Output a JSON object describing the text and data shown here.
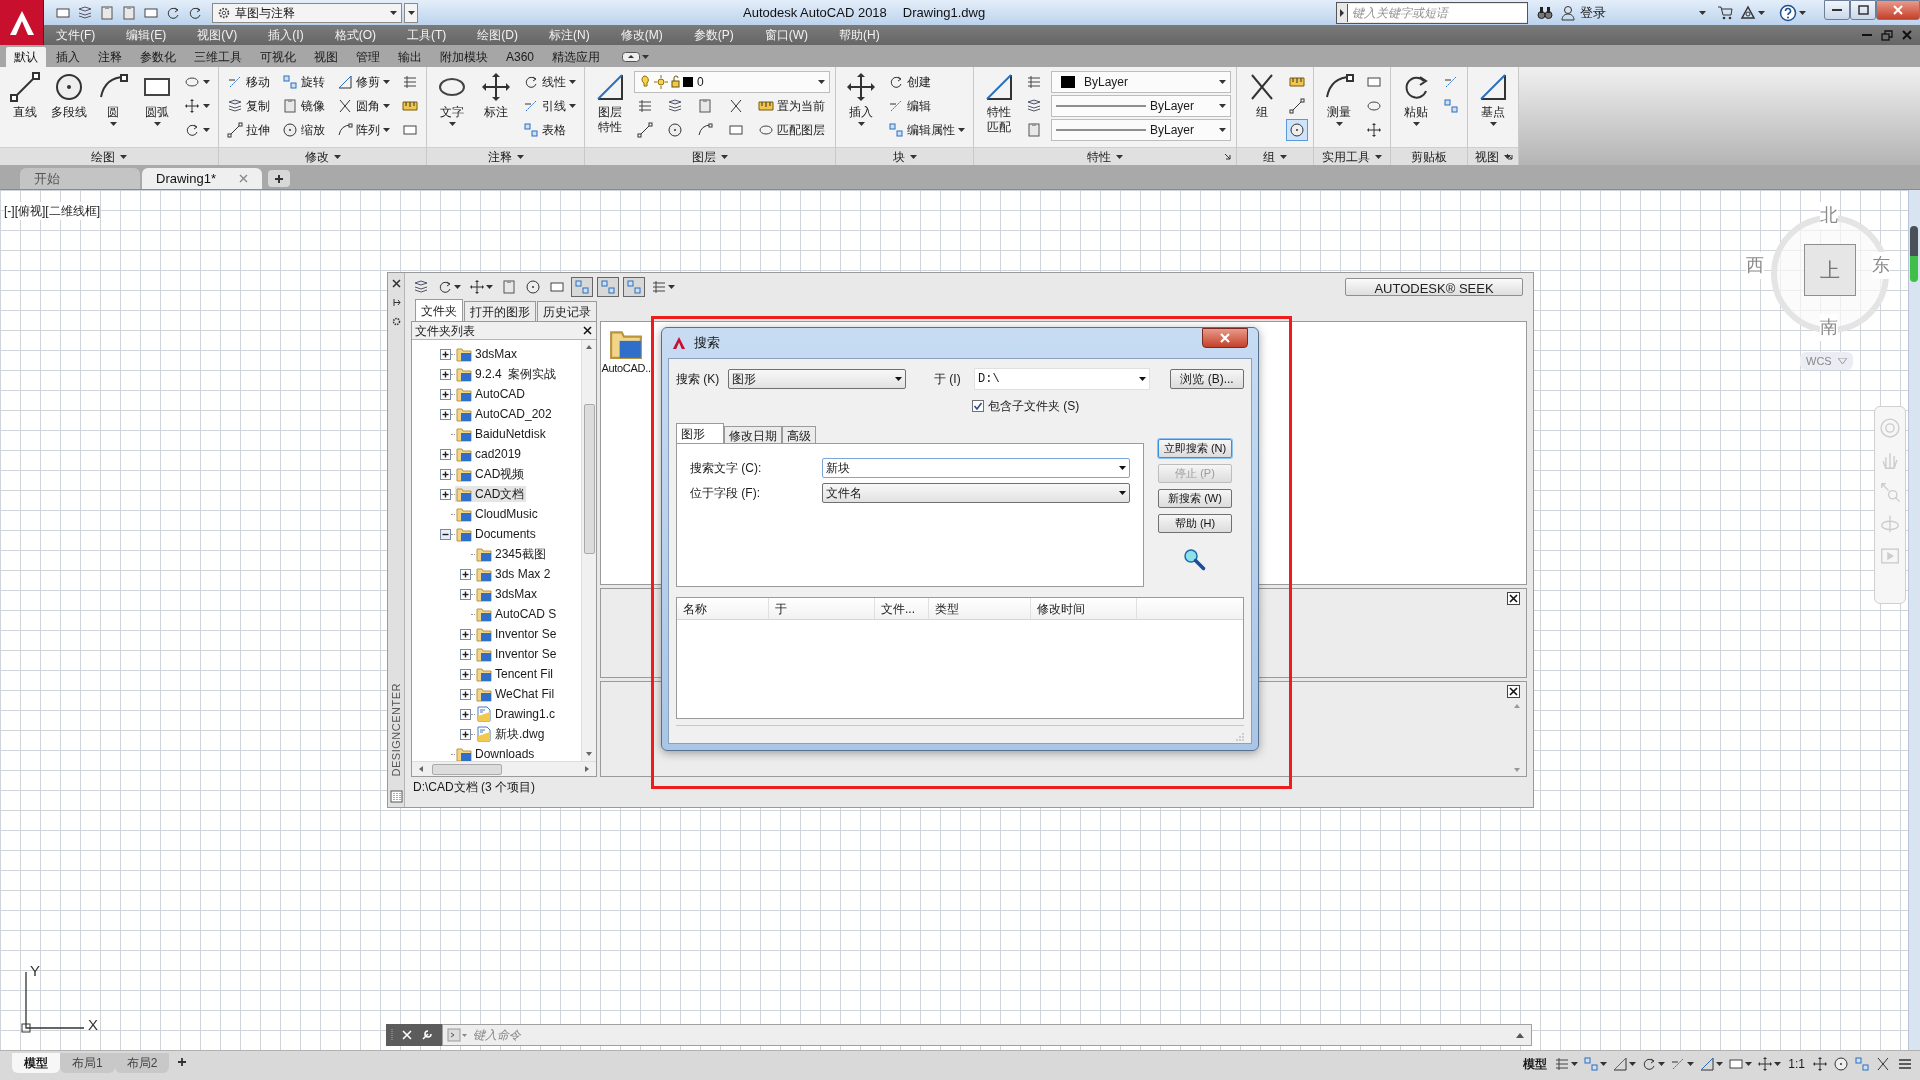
{
  "title_bar": {
    "workspace": "草图与注释",
    "app_title": "Autodesk AutoCAD 2018",
    "document": "Drawing1.dwg",
    "search_placeholder": "键入关键字或短语",
    "sign_in": "登录"
  },
  "menu_bar": [
    "文件(F)",
    "编辑(E)",
    "视图(V)",
    "插入(I)",
    "格式(O)",
    "工具(T)",
    "绘图(D)",
    "标注(N)",
    "修改(M)",
    "参数(P)",
    "窗口(W)",
    "帮助(H)"
  ],
  "ribbon_tabs": [
    {
      "label": "默认",
      "selected": true
    },
    {
      "label": "插入",
      "selected": false
    },
    {
      "label": "注释",
      "selected": false
    },
    {
      "label": "参数化",
      "selected": false
    },
    {
      "label": "三维工具",
      "selected": false
    },
    {
      "label": "可视化",
      "selected": false
    },
    {
      "label": "视图",
      "selected": false
    },
    {
      "label": "管理",
      "selected": false
    },
    {
      "label": "输出",
      "selected": false
    },
    {
      "label": "附加模块",
      "selected": false
    },
    {
      "label": "A360",
      "selected": false
    },
    {
      "label": "精选应用",
      "selected": false
    }
  ],
  "ribbon_panels": [
    {
      "title": "绘图",
      "menu": true,
      "launcher": false,
      "large": [
        {
          "label": "直线",
          "dropdown": false
        },
        {
          "label": "多段线",
          "dropdown": false
        },
        {
          "label": "圆",
          "dropdown": true
        },
        {
          "label": "圆弧",
          "dropdown": true
        }
      ],
      "rows": [
        [
          {
            "kind": "tool",
            "dropdown": true
          }
        ],
        [
          {
            "kind": "tool",
            "dropdown": true
          }
        ],
        [
          {
            "kind": "tool",
            "dropdown": true
          }
        ]
      ]
    },
    {
      "title": "修改",
      "menu": true,
      "launcher": false,
      "rows": [
        [
          {
            "kind": "tool",
            "label": "移动",
            "dropdown": false
          },
          {
            "kind": "tool",
            "label": "旋转",
            "dropdown": false
          },
          {
            "kind": "tool",
            "label": "修剪",
            "dropdown": true
          },
          {
            "kind": "tool",
            "dropdown": false
          }
        ],
        [
          {
            "kind": "tool",
            "label": "复制",
            "dropdown": false
          },
          {
            "kind": "tool",
            "label": "镜像",
            "dropdown": false
          },
          {
            "kind": "tool",
            "label": "圆角",
            "dropdown": true
          },
          {
            "kind": "tool",
            "dropdown": false
          }
        ],
        [
          {
            "kind": "tool",
            "label": "拉伸",
            "dropdown": false
          },
          {
            "kind": "tool",
            "label": "缩放",
            "dropdown": false
          },
          {
            "kind": "tool",
            "label": "阵列",
            "dropdown": true
          },
          {
            "kind": "tool",
            "dropdown": false
          }
        ]
      ]
    },
    {
      "title": "注释",
      "menu": true,
      "launcher": false,
      "large": [
        {
          "label": "文字",
          "dropdown": true
        },
        {
          "label": "标注",
          "dropdown": false
        }
      ],
      "rows": [
        [
          {
            "kind": "tool",
            "label": "线性",
            "dropdown": true
          }
        ],
        [
          {
            "kind": "tool",
            "label": "引线",
            "dropdown": true
          }
        ],
        [
          {
            "kind": "tool",
            "label": "表格",
            "dropdown": false
          }
        ]
      ]
    },
    {
      "title": "图层",
      "menu": true,
      "launcher": false,
      "large": [
        {
          "label": "图层特性",
          "dropdown": false
        }
      ],
      "rows": [
        [
          {
            "kind": "layer-combo",
            "value": "0"
          }
        ],
        [
          {
            "kind": "tool",
            "dropdown": false
          },
          {
            "kind": "tool",
            "dropdown": false
          },
          {
            "kind": "tool",
            "dropdown": false
          },
          {
            "kind": "tool",
            "dropdown": false
          },
          {
            "kind": "tool",
            "label": "置为当前",
            "dropdown": false
          }
        ],
        [
          {
            "kind": "tool",
            "dropdown": false
          },
          {
            "kind": "tool",
            "dropdown": false
          },
          {
            "kind": "tool",
            "dropdown": false
          },
          {
            "kind": "tool",
            "dropdown": false
          },
          {
            "kind": "tool",
            "label": "匹配图层",
            "dropdown": false
          }
        ]
      ]
    },
    {
      "title": "块",
      "menu": true,
      "launcher": false,
      "large": [
        {
          "label": "插入",
          "dropdown": true
        }
      ],
      "rows": [
        [
          {
            "kind": "tool",
            "label": "创建",
            "dropdown": false
          }
        ],
        [
          {
            "kind": "tool",
            "label": "编辑",
            "dropdown": false
          }
        ],
        [
          {
            "kind": "tool",
            "label": "编辑属性",
            "dropdown": true
          }
        ]
      ]
    },
    {
      "title": "特性",
      "menu": true,
      "launcher": true,
      "large": [
        {
          "label": "特性匹配",
          "dropdown": false
        }
      ],
      "rows": [
        [
          {
            "kind": "tool",
            "dropdown": false
          },
          {
            "kind": "color-combo",
            "value": "ByLayer"
          }
        ],
        [
          {
            "kind": "tool",
            "dropdown": false
          },
          {
            "kind": "line-combo",
            "value": "ByLayer"
          }
        ],
        [
          {
            "kind": "tool",
            "dropdown": false
          },
          {
            "kind": "line-combo",
            "value": "ByLayer"
          }
        ]
      ]
    },
    {
      "title": "组",
      "menu": true,
      "launcher": false,
      "large": [
        {
          "label": "组",
          "dropdown": false
        }
      ],
      "rows": [
        [
          {
            "kind": "tool",
            "dropdown": false,
            "active": false
          }
        ],
        [
          {
            "kind": "tool",
            "dropdown": false,
            "active": false
          }
        ],
        [
          {
            "kind": "tool",
            "dropdown": false,
            "active": true
          }
        ]
      ]
    },
    {
      "title": "实用工具",
      "menu": true,
      "launcher": false,
      "large": [
        {
          "label": "测量",
          "dropdown": true
        }
      ],
      "rows": [
        [
          {
            "kind": "tool",
            "dropdown": false
          }
        ],
        [
          {
            "kind": "tool",
            "dropdown": false
          }
        ],
        [
          {
            "kind": "tool",
            "dropdown": false
          }
        ]
      ]
    },
    {
      "title": "剪贴板",
      "menu": false,
      "launcher": false,
      "large": [
        {
          "label": "粘贴",
          "dropdown": true
        }
      ],
      "rows": [
        [
          {
            "kind": "tool",
            "dropdown": false
          }
        ],
        [
          {
            "kind": "tool",
            "dropdown": false
          }
        ]
      ]
    },
    {
      "title": "视图",
      "menu": true,
      "launcher": true,
      "large": [
        {
          "label": "基点",
          "dropdown": true
        }
      ]
    }
  ],
  "file_tabs": [
    {
      "label": "开始",
      "selected": false,
      "closable": false
    },
    {
      "label": "Drawing1*",
      "selected": true,
      "closable": true
    }
  ],
  "viewport_label": "[-][俯视][二维线框]",
  "viewcube": {
    "north": "北",
    "south": "南",
    "east": "东",
    "west": "西",
    "face": "上",
    "ucs": "WCS"
  },
  "ucs_icon": {
    "y": "Y",
    "x": "X"
  },
  "design_center": {
    "title": "DESIGNCENTER",
    "seek_button": "AUTODESK® SEEK",
    "tabs": [
      {
        "label": "文件夹",
        "selected": true
      },
      {
        "label": "打开的图形",
        "selected": false
      },
      {
        "label": "历史记录",
        "selected": false
      }
    ],
    "tree_header": "文件夹列表",
    "tree": [
      {
        "label": "3dsMax",
        "kind": "folder",
        "expandable": true,
        "expanded": false,
        "selected": false
      },
      {
        "label": "9.2.4  案例实战",
        "kind": "folder",
        "expandable": true,
        "expanded": false,
        "selected": false
      },
      {
        "label": "AutoCAD",
        "kind": "folder",
        "expandable": true,
        "expanded": false,
        "selected": false
      },
      {
        "label": "AutoCAD_202",
        "kind": "folder",
        "expandable": true,
        "expanded": false,
        "selected": false
      },
      {
        "label": "BaiduNetdisk",
        "kind": "folder",
        "expandable": false,
        "selected": false
      },
      {
        "label": "cad2019",
        "kind": "folder",
        "expandable": true,
        "expanded": false,
        "selected": false
      },
      {
        "label": "CAD视频",
        "kind": "folder",
        "expandable": true,
        "expanded": false,
        "selected": false
      },
      {
        "label": "CAD文档",
        "kind": "folder",
        "expandable": true,
        "expanded": false,
        "selected": true
      },
      {
        "label": "CloudMusic",
        "kind": "folder",
        "expandable": false,
        "selected": false
      },
      {
        "label": "Documents",
        "kind": "folder",
        "expandable": true,
        "expanded": true,
        "selected": false,
        "children": [
          {
            "label": "2345截图",
            "kind": "folder",
            "expandable": false,
            "selected": false
          },
          {
            "label": "3ds Max 2",
            "kind": "folder",
            "expandable": true,
            "expanded": false,
            "selected": false
          },
          {
            "label": "3dsMax",
            "kind": "folder",
            "expandable": true,
            "expanded": false,
            "selected": false
          },
          {
            "label": "AutoCAD S",
            "kind": "folder",
            "expandable": false,
            "selected": false
          },
          {
            "label": "Inventor Se",
            "kind": "folder",
            "expandable": true,
            "expanded": false,
            "selected": false
          },
          {
            "label": "Inventor Se",
            "kind": "folder",
            "expandable": true,
            "expanded": false,
            "selected": false
          },
          {
            "label": "Tencent Fil",
            "kind": "folder",
            "expandable": true,
            "expanded": false,
            "selected": false
          },
          {
            "label": "WeChat Fil",
            "kind": "folder",
            "expandable": true,
            "expanded": false,
            "selected": false
          },
          {
            "label": "Drawing1.c",
            "kind": "drawing",
            "expandable": true,
            "expanded": false,
            "selected": false
          },
          {
            "label": "新块.dwg",
            "kind": "drawing",
            "expandable": true,
            "expanded": false,
            "selected": false
          }
        ]
      },
      {
        "label": "Downloads",
        "kind": "folder",
        "expandable": false,
        "selected": false
      }
    ],
    "content_items": [
      {
        "label": "AutoCAD.."
      }
    ],
    "status": "D:\\CAD文档 (3 个项目)"
  },
  "search_dialog": {
    "title": "搜索",
    "look_for_label": "搜索 (K)",
    "look_for": "图形",
    "in_label": "于 (I)",
    "in": "D:\\",
    "browse": "浏览 (B)...",
    "include_subfolders": {
      "label": "包含子文件夹 (S)",
      "checked": true
    },
    "tabs": [
      {
        "label": "图形",
        "selected": true
      },
      {
        "label": "修改日期",
        "selected": false
      },
      {
        "label": "高级",
        "selected": false
      }
    ],
    "fields": [
      {
        "label": "搜索文字 (C):",
        "value": "新块",
        "editable": true
      },
      {
        "label": "位于字段 (F):",
        "value": "文件名",
        "editable": false
      }
    ],
    "buttons": [
      {
        "label": "立即搜索 (N)",
        "default": true,
        "disabled": false
      },
      {
        "label": "停止 (P)",
        "default": false,
        "disabled": true
      },
      {
        "label": "新搜索 (W)",
        "default": false,
        "disabled": false
      },
      {
        "label": "帮助 (H)",
        "default": false,
        "disabled": false
      }
    ],
    "columns": [
      "名称",
      "于",
      "文件...",
      "类型",
      "修改时间"
    ]
  },
  "command_line": {
    "placeholder": "键入命令"
  },
  "layout_tabs": [
    {
      "label": "模型",
      "selected": true
    },
    {
      "label": "布局1",
      "selected": false
    },
    {
      "label": "布局2",
      "selected": false
    }
  ],
  "status_bar": {
    "space": "模型",
    "scale": "1:1"
  }
}
